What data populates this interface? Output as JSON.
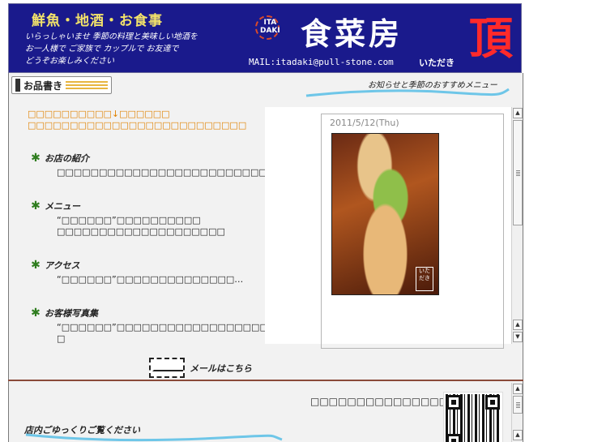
{
  "header": {
    "tagline": "鮮魚・地酒・お食事",
    "welcome_lines": [
      "いらっしゃいませ 季節の料理と美味しい地酒を",
      "お一人様で ご家族で カップルで お友達で",
      "どうぞお楽しみください"
    ],
    "logo_word_1": "ITA",
    "logo_word_2": "DAKI",
    "shop_name": "食菜房",
    "mail": "MAIL:itadaki@pull-stone.com",
    "kana_name": "いただき",
    "big_kanji": "頂"
  },
  "menu_tab": {
    "label": "お品書き"
  },
  "news_title": "お知らせと季節のおすすめメニュー",
  "notice_lines": [
    "□□□□□□□□□□↓□□□□□□",
    "□□□□□□□□□□□□□□□□□□□□□□□□□□"
  ],
  "sections": [
    {
      "heading": "お店の紹介",
      "lines": [
        "□□□□□□□□□□□□□□□□□□□□□□□□□□□□□□□□□□□□□"
      ]
    },
    {
      "heading": "メニュー",
      "lines": [
        "“□□□□□□”□□□□□□□□□□",
        "□□□□□□□□□□□□□□□□□□□□"
      ]
    },
    {
      "heading": "アクセス",
      "lines": [
        "“□□□□□□”□□□□□□□□□□□□□□…"
      ]
    },
    {
      "heading": "お客様写真集",
      "lines": [
        "“□□□□□□”□□□□□□□□□□□□□□□□□□□□□□□□□□□□□□",
        "□"
      ]
    }
  ],
  "mail_link": {
    "label": "メールはこちら"
  },
  "blog": {
    "date": "2011/5/12(Thu)",
    "photo_stamp": "いただき"
  },
  "bottom": {
    "text": "□□□□□□□□□□□□□□□□!!",
    "inside_title": "店内ごゆっくりご覧ください"
  },
  "colors": {
    "banner_bg": "#1a1a8c",
    "notice_orange": "#e08200",
    "kanji_red": "#ff2a2a",
    "divider_brown": "#8a4a3a"
  }
}
